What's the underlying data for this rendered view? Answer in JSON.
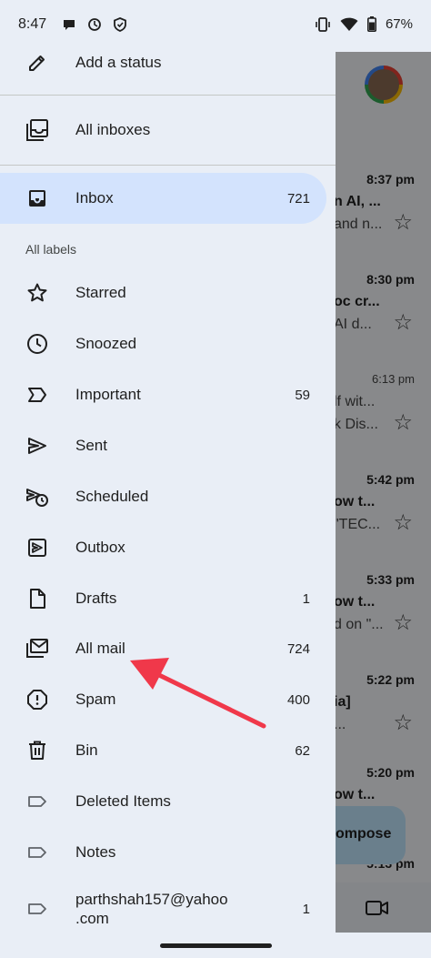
{
  "status_bar": {
    "time": "8:47",
    "battery": "67%",
    "left_icons": [
      "chat-bubble-icon",
      "sync-icon",
      "shield-icon"
    ],
    "right_icons": [
      "vibrate-icon",
      "wifi-icon",
      "battery-icon"
    ]
  },
  "drawer": {
    "add_status": "Add a status",
    "all_inboxes": "All inboxes",
    "inbox": {
      "label": "Inbox",
      "count": "721"
    },
    "section_label": "All labels",
    "items": [
      {
        "label": "Starred",
        "count": "",
        "icon": "star-icon"
      },
      {
        "label": "Snoozed",
        "count": "",
        "icon": "clock-icon"
      },
      {
        "label": "Important",
        "count": "59",
        "icon": "important-icon"
      },
      {
        "label": "Sent",
        "count": "",
        "icon": "send-icon"
      },
      {
        "label": "Scheduled",
        "count": "",
        "icon": "scheduled-icon"
      },
      {
        "label": "Outbox",
        "count": "",
        "icon": "outbox-icon"
      },
      {
        "label": "Drafts",
        "count": "1",
        "icon": "draft-icon"
      },
      {
        "label": "All mail",
        "count": "724",
        "icon": "all-mail-icon"
      },
      {
        "label": "Spam",
        "count": "400",
        "icon": "spam-icon"
      },
      {
        "label": "Bin",
        "count": "62",
        "icon": "trash-icon"
      },
      {
        "label": "Deleted Items",
        "count": "",
        "icon": "label-icon"
      },
      {
        "label": "Notes",
        "count": "",
        "icon": "label-icon"
      }
    ],
    "yahoo_label_line1": "parthshah157@yahoo",
    "yahoo_label_line2": ".com",
    "yahoo_count": "1"
  },
  "background_list": {
    "rows": [
      {
        "time": "8:37 pm",
        "subject": "n AI, ...",
        "preview": "and n..."
      },
      {
        "time": "8:30 pm",
        "subject": "oc cr...",
        "preview": "AI d..."
      },
      {
        "time": "6:13 pm",
        "subject": "lf wit...",
        "preview": "k Dis..."
      },
      {
        "time": "5:42 pm",
        "subject": "ow t...",
        "preview": "\"TEC..."
      },
      {
        "time": "5:33 pm",
        "subject": "ow t...",
        "preview": "d on \"..."
      },
      {
        "time": "5:22 pm",
        "subject": "ia]",
        "preview": "..."
      },
      {
        "time": "5:20 pm",
        "subject": "ow t...",
        "preview": ""
      },
      {
        "time": "5:13 pm",
        "subject": "",
        "preview": ""
      }
    ],
    "compose_label": "ompose"
  },
  "colors": {
    "drawer_bg": "#e9eef6",
    "active_bg": "#d3e3fd",
    "arrow": "#f0384a"
  }
}
